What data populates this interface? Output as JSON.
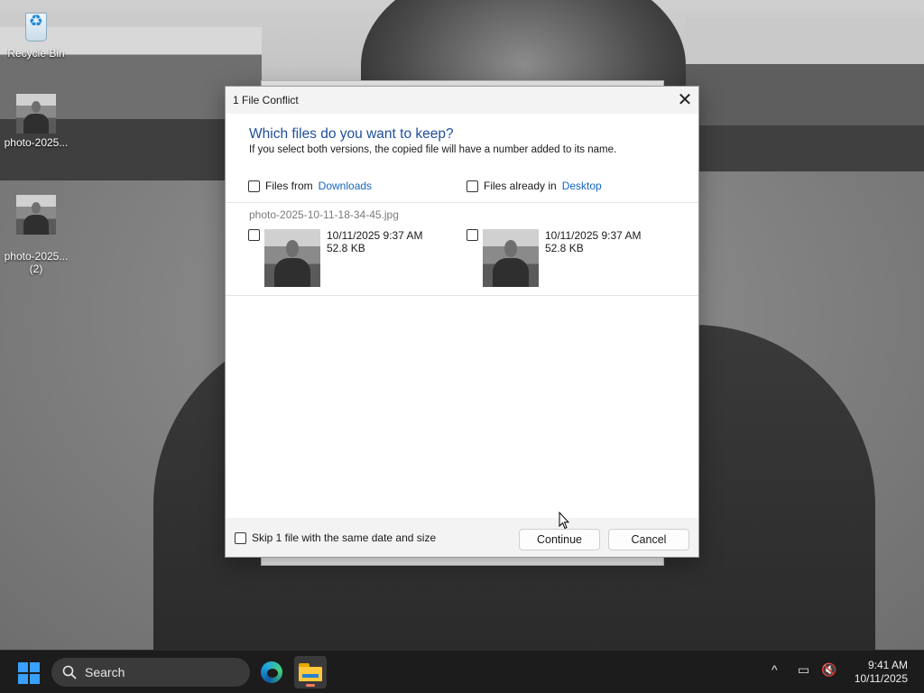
{
  "desktop": {
    "icons": [
      {
        "label": "Recycle Bin"
      },
      {
        "label": "photo-2025..."
      },
      {
        "label": "photo-2025...\n(2)"
      }
    ]
  },
  "dialog": {
    "title": "1 File Conflict",
    "heading": "Which files do you want to keep?",
    "subheading": "If you select both versions, the copied file will have a number added to its name.",
    "source": {
      "prefix": "Files from",
      "location": "Downloads"
    },
    "destination": {
      "prefix": "Files already in",
      "location": "Desktop"
    },
    "file": {
      "name": "photo-2025-10-11-18-34-45.jpg",
      "left": {
        "date": "10/11/2025 9:37 AM",
        "size": "52.8 KB"
      },
      "right": {
        "date": "10/11/2025 9:37 AM",
        "size": "52.8 KB"
      }
    },
    "skip_label": "Skip 1 file with the same date and size",
    "continue_label": "Continue",
    "cancel_label": "Cancel",
    "close_glyph": "✕"
  },
  "taskbar": {
    "search_label": "Search",
    "clock": {
      "time": "9:41 AM",
      "date": "10/11/2025"
    },
    "tray": {
      "chevron": "^",
      "display": "▭",
      "volume": "🔇"
    }
  },
  "colors": {
    "accent": "#1f4e9c",
    "link": "#1565c0",
    "taskbar": "#1c1c1c",
    "active_indicator": "#ff7a5c"
  }
}
